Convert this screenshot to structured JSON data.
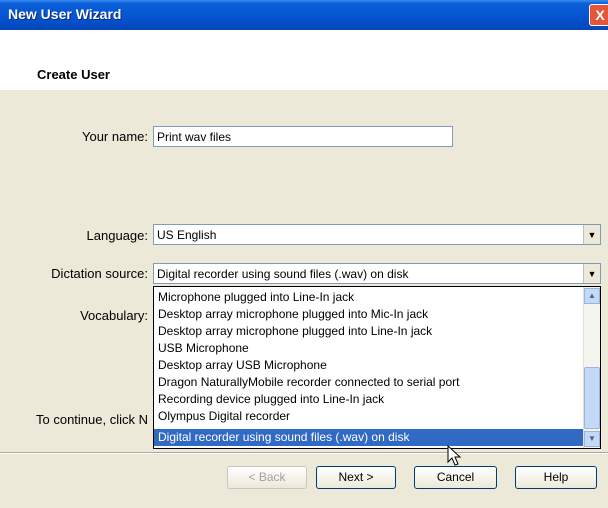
{
  "window": {
    "title": "New User Wizard",
    "close_glyph": "X"
  },
  "page": {
    "heading": "Create User"
  },
  "form": {
    "name_label": "Your name:",
    "name_value": "Print wav files",
    "language_label": "Language:",
    "language_value": "US English",
    "dictation_label": "Dictation source:",
    "dictation_value": "Digital recorder using sound files (.wav) on disk",
    "vocabulary_label": "Vocabulary:",
    "continue_text": "To continue, click N"
  },
  "dropdown": {
    "items": [
      "Microphone plugged into Line-In jack",
      "Desktop array microphone plugged into Mic-In jack",
      "Desktop array microphone plugged into Line-In jack",
      "USB Microphone",
      "Desktop array USB Microphone",
      "Dragon NaturallyMobile recorder connected to serial port",
      "Recording device plugged into Line-In jack",
      "Olympus Digital recorder",
      "Digital recorder using sound files (.wav) on disk"
    ],
    "selected_index": 8
  },
  "buttons": {
    "back": "< Back",
    "next": "Next >",
    "cancel": "Cancel",
    "help": "Help"
  },
  "icons": {
    "combo_arrow": "chevron-down-icon",
    "scroll_up": "scroll-up-icon",
    "scroll_down": "scroll-down-icon",
    "cursor": "pointer-cursor-icon"
  }
}
